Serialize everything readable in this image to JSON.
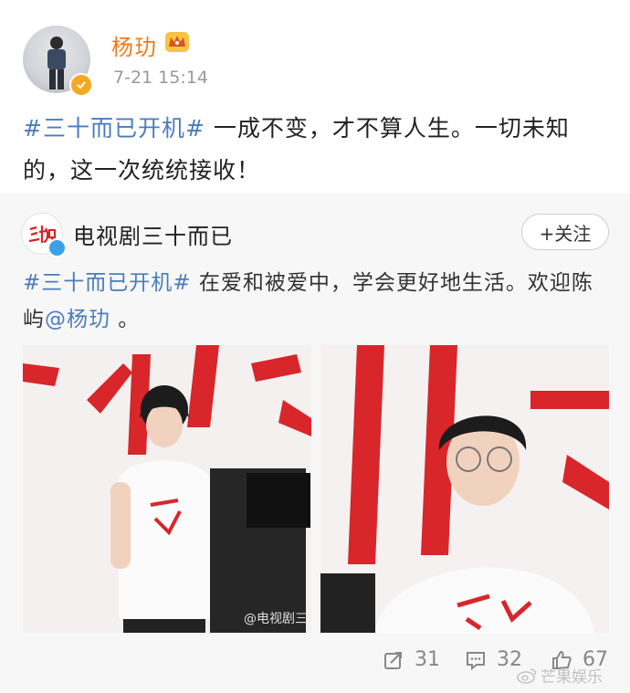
{
  "post": {
    "username": "杨玏",
    "timestamp": "7-21 15:14",
    "hashtag": "#三十而已开机#",
    "text_after_hashtag": " 一成不变，才不算人生。一切未知的，这一次统统接收！"
  },
  "repost": {
    "account_name": "电视剧三十而已",
    "follow_label": "+关注",
    "hashtag": "#三十而已开机#",
    "text_part1": " 在爱和被爱中，学会更好地生活。欢迎陈屿",
    "mention": "@杨玏",
    "text_part2": " 。",
    "photo_watermark": "@电视剧三"
  },
  "actions": {
    "reposts": "31",
    "comments": "32",
    "likes": "67"
  },
  "corner_watermark": "芒果娱乐",
  "colors": {
    "username": "#f07b1b",
    "link": "#4a7cbc",
    "repost_bg": "#f7f7f7",
    "verified_gold": "#f6a823",
    "verified_blue": "#3aa1e8"
  },
  "icons": [
    "crown-icon",
    "verified-badge-icon",
    "repost-icon",
    "comment-icon",
    "like-icon"
  ]
}
